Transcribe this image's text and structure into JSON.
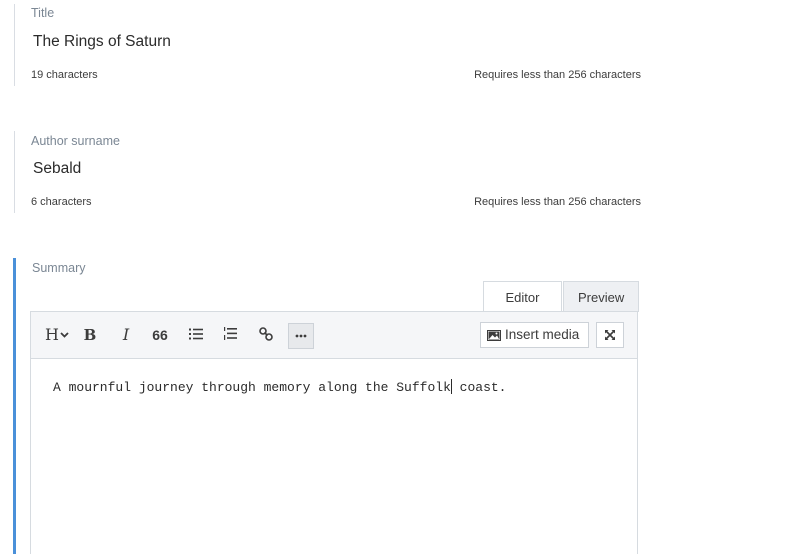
{
  "title_field": {
    "label": "Title",
    "value": "The Rings of Saturn",
    "count": "19 characters",
    "hint": "Requires less than 256 characters"
  },
  "author_field": {
    "label": "Author surname",
    "value": "Sebald",
    "count": "6 characters",
    "hint": "Requires less than 256 characters"
  },
  "summary_field": {
    "label": "Summary",
    "tabs": [
      {
        "label": "Editor",
        "selected": true
      },
      {
        "label": "Preview",
        "selected": false
      }
    ],
    "toolbar": {
      "heading": "H",
      "bold": "B",
      "italic": "I",
      "quote": "66",
      "insert_media": "Insert media"
    },
    "content_before_caret": "A mournful journey through memory along the Suffolk",
    "content_after_caret": " coast."
  },
  "colors": {
    "accent": "#4a90d9",
    "label": "#7b8794",
    "border": "#d6dbe0",
    "toolbar_bg": "#f5f6f8"
  },
  "icons": [
    "chevron-down-icon",
    "unordered-list-icon",
    "ordered-list-icon",
    "link-icon",
    "more-icon",
    "image-icon",
    "expand-icon"
  ]
}
